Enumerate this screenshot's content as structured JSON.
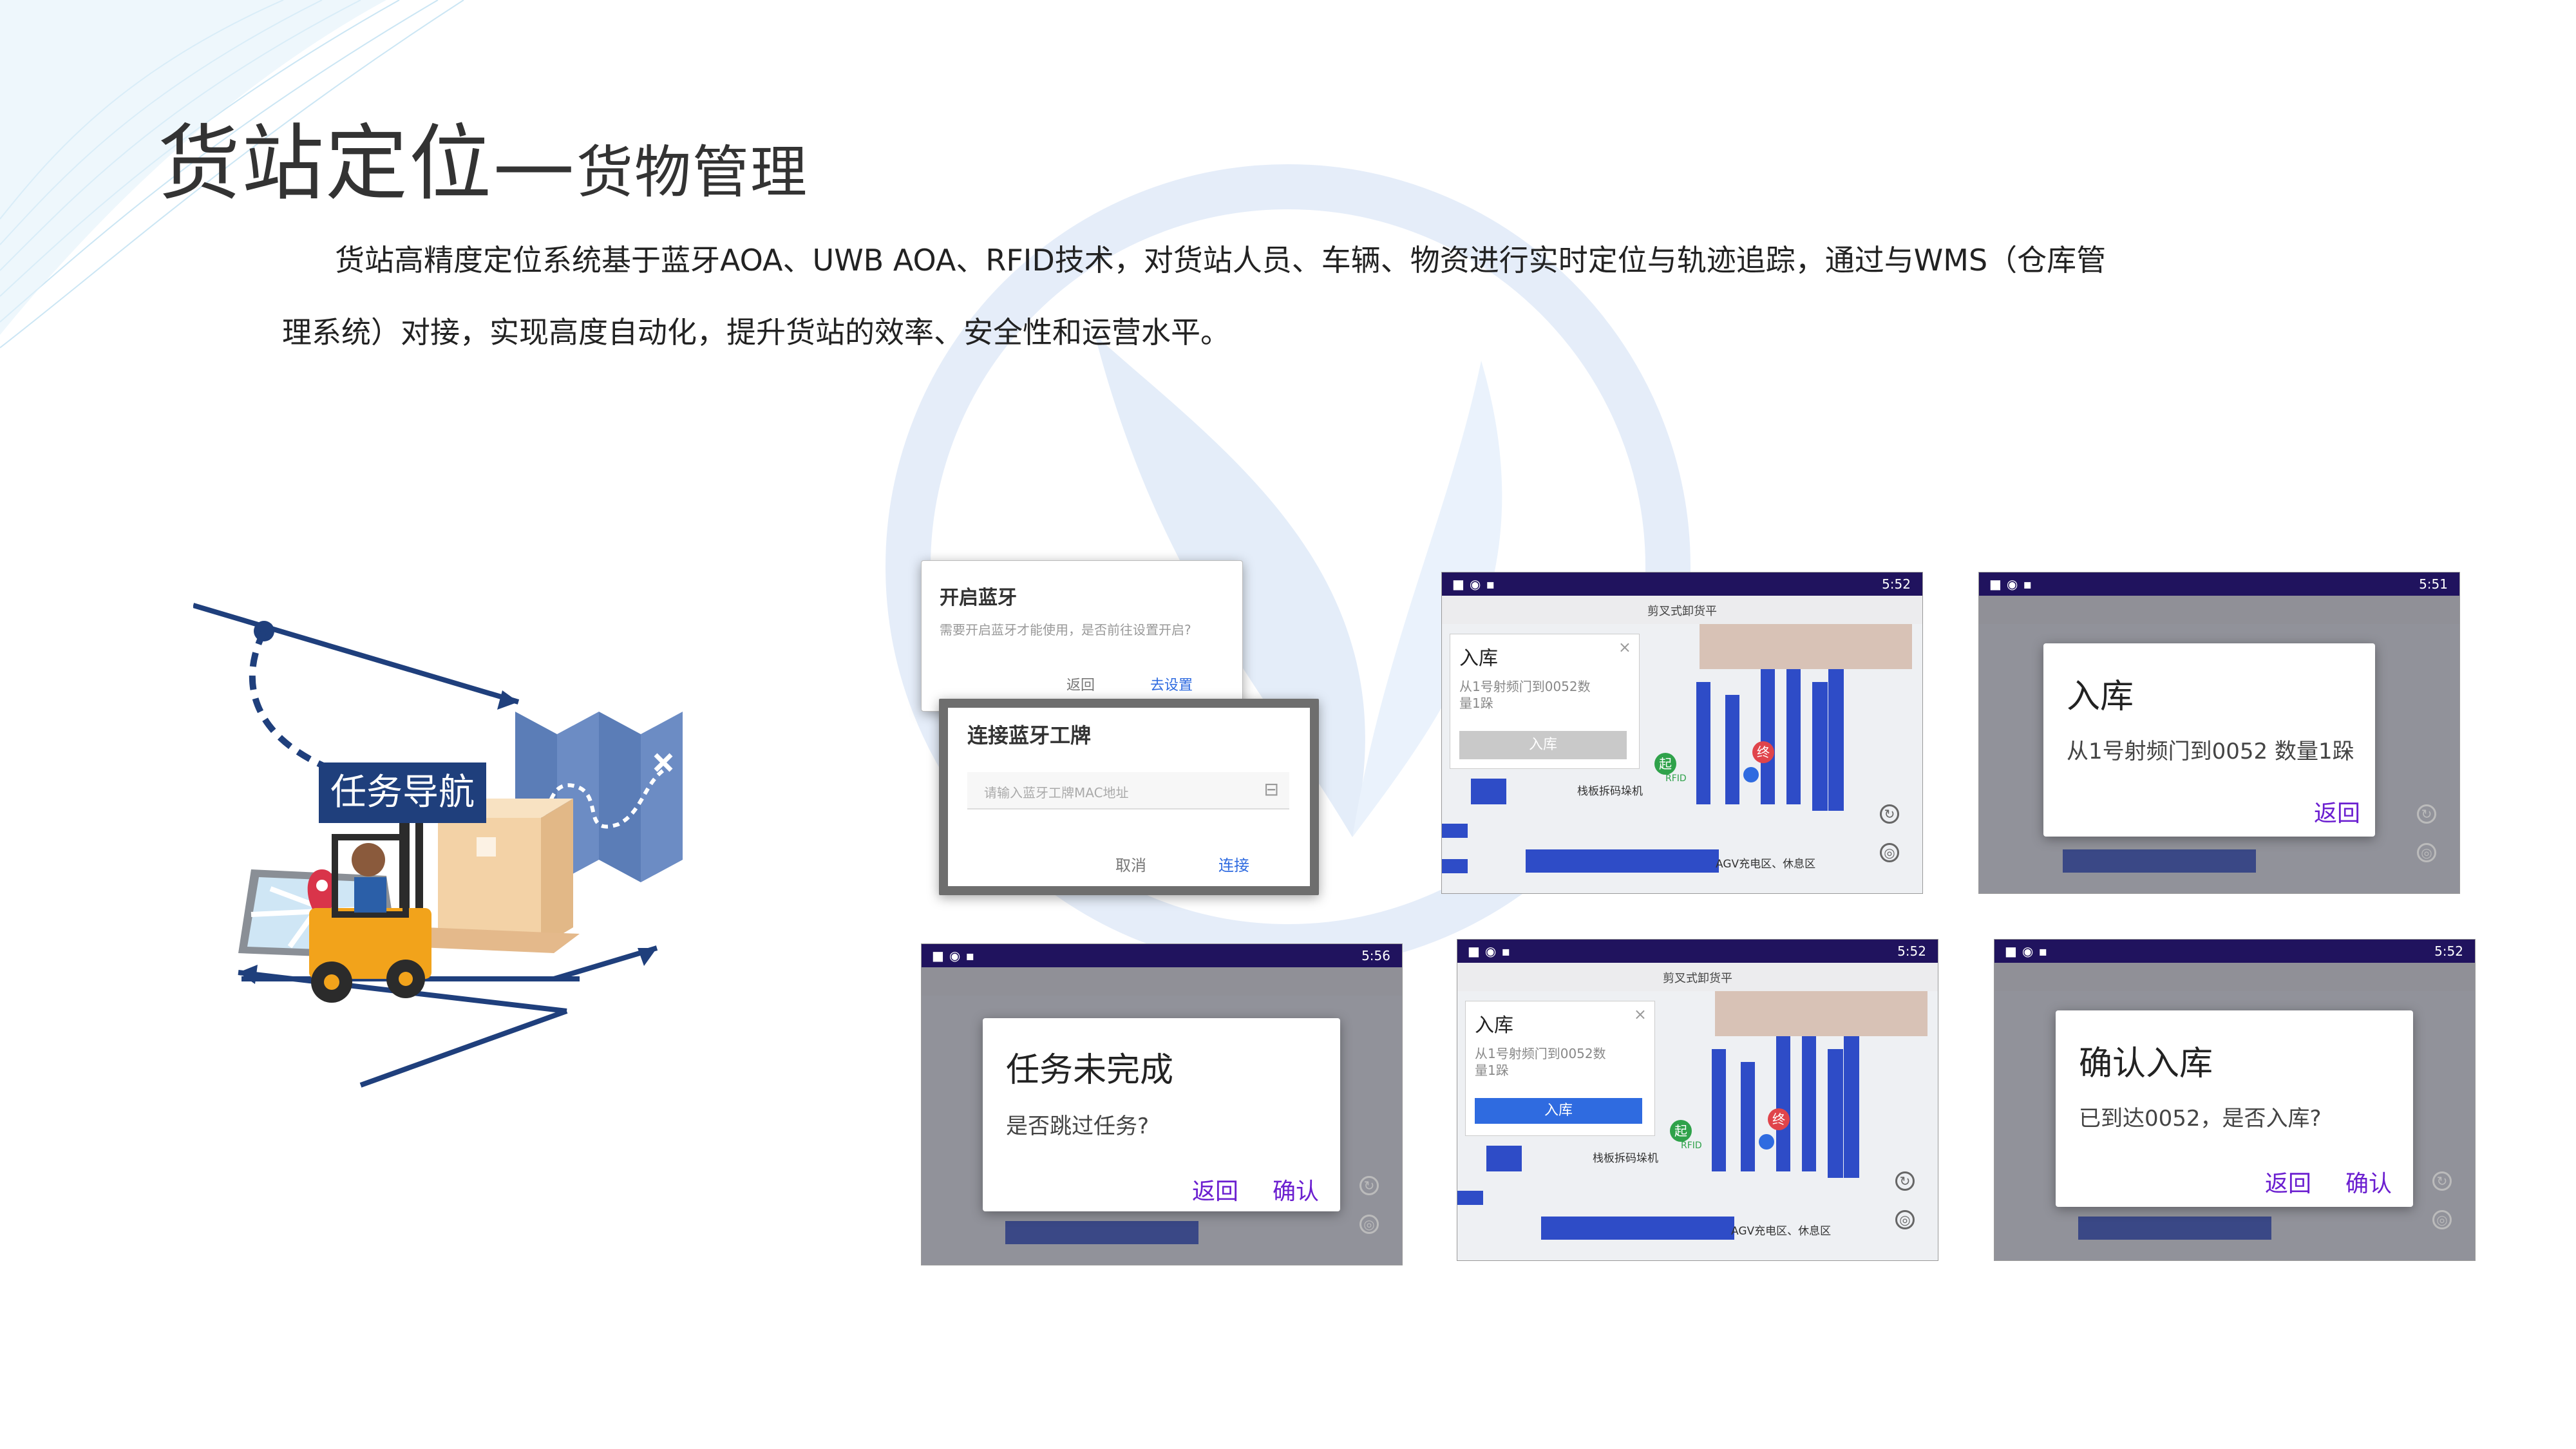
{
  "title": {
    "main": "货站定位",
    "dash": "—",
    "sub": "货物管理"
  },
  "intro": {
    "line1": "货站高精度定位系统基于蓝牙AOA、UWB AOA、RFID技术，对货站人员、车辆、物资进行实时定位与轨迹追踪，通过与WMS（仓库管",
    "line2": "理系统）对接，实现高度自动化，提升货站的效率、安全性和运营水平。"
  },
  "illustration": {
    "nav_label": "任务导航",
    "icons": [
      "map-pin-icon",
      "folded-map-icon",
      "forklift-icon",
      "tablet-map-icon"
    ]
  },
  "screenshots": {
    "bluetooth": {
      "enable_title": "开启蓝牙",
      "enable_msg": "需要开启蓝牙才能使用，是否前往设置开启?",
      "enable_back": "返回",
      "enable_settings": "去设置",
      "connect_title": "连接蓝牙工牌",
      "connect_placeholder": "请输入蓝牙工牌MAC地址",
      "connect_cancel": "取消",
      "connect_ok": "连接"
    },
    "map_a": {
      "time": "5:52",
      "header": "剪叉式卸货平",
      "panel_title": "入库",
      "panel_text": "从1号射频门到0052数量1跺",
      "panel_btn": "入库",
      "start": "起",
      "end": "终",
      "rfid": "RFID",
      "label_pallet": "栈板拆码垛机",
      "label_area": "AGV充电区、休息区"
    },
    "dialog_inbound": {
      "time": "5:51",
      "title": "入库",
      "message": "从1号射频门到0052 数量1跺",
      "back": "返回"
    },
    "dialog_task": {
      "time": "5:56",
      "title": "任务未完成",
      "message": "是否跳过任务?",
      "back": "返回",
      "confirm": "确认"
    },
    "map_b": {
      "time": "5:52",
      "header": "剪叉式卸货平",
      "panel_title": "入库",
      "panel_text": "从1号射频门到0052数量1跺",
      "panel_btn": "入库",
      "start": "起",
      "end": "终",
      "rfid": "RFID",
      "label_pallet": "栈板拆码垛机",
      "label_area": "AGV充电区、休息区"
    },
    "dialog_confirm": {
      "time": "5:52",
      "title": "确认入库",
      "message": "已到达0052，是否入库?",
      "back": "返回",
      "confirm": "确认"
    }
  },
  "colors": {
    "accent": "#1f3f7c",
    "status_bar": "#20135e",
    "dialog_button": "#6b1fd0",
    "shelf": "#2e4cc7"
  }
}
